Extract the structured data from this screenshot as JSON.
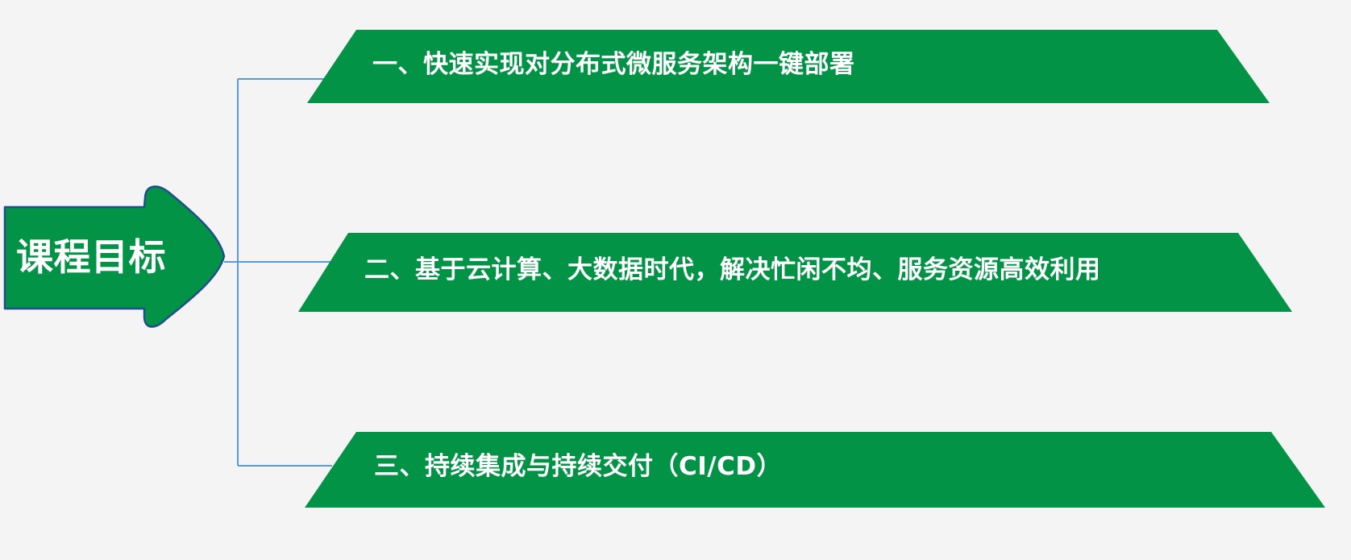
{
  "colors": {
    "background": "#f4f4f4",
    "green_fill": "#029347",
    "arrow_outline": "#1f4e8c",
    "connector": "#5b9bd5",
    "label_text": "#ffffff"
  },
  "arrow": {
    "label": "课程目标"
  },
  "goals": [
    {
      "label": "一、快速实现对分布式微服务架构一键部署"
    },
    {
      "label": "二、基于云计算、大数据时代，解决忙闲不均、服务资源高效利用"
    },
    {
      "label": "三、持续集成与持续交付（CI/CD）"
    }
  ]
}
